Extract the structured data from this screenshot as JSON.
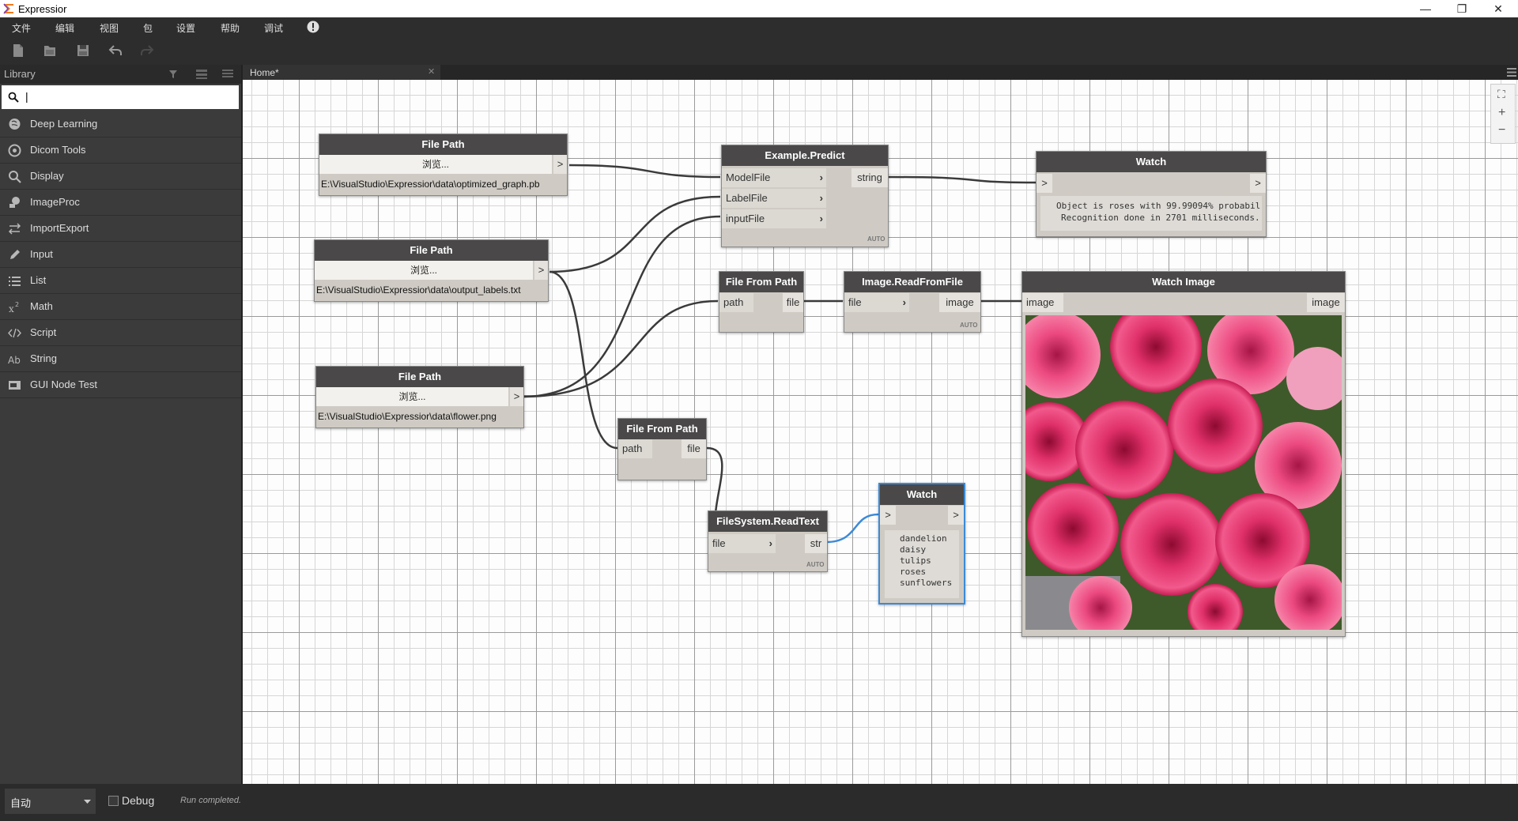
{
  "window": {
    "title": "Expressior",
    "minimize": "—",
    "restore": "❐",
    "close": "✕"
  },
  "menu": {
    "items": [
      "文件",
      "编辑",
      "视图",
      "包",
      "设置",
      "帮助",
      "调试"
    ],
    "info_icon": "info-circle-icon"
  },
  "toolbar": {
    "icons": [
      "new-file-icon",
      "open-file-icon",
      "save-icon",
      "undo-icon",
      "redo-icon"
    ]
  },
  "library": {
    "title": "Library",
    "search_value": "|",
    "items": [
      {
        "label": "Deep Learning",
        "icon": "brain-icon"
      },
      {
        "label": "Dicom Tools",
        "icon": "disc-icon"
      },
      {
        "label": "Display",
        "icon": "magnifier-icon"
      },
      {
        "label": "ImageProc",
        "icon": "image-proc-icon"
      },
      {
        "label": "ImportExport",
        "icon": "swap-arrows-icon"
      },
      {
        "label": "Input",
        "icon": "pencil-icon"
      },
      {
        "label": "List",
        "icon": "list-icon"
      },
      {
        "label": "Math",
        "icon": "x-squared-icon"
      },
      {
        "label": "Script",
        "icon": "code-icon"
      },
      {
        "label": "String",
        "icon": "ab-text-icon"
      },
      {
        "label": "GUI Node Test",
        "icon": "gui-node-icon"
      }
    ]
  },
  "tabs": {
    "home_label": "Home*",
    "close": "✕"
  },
  "nodes": {
    "fp1": {
      "title": "File Path",
      "button": "浏览...",
      "out": ">",
      "path": "E:\\VisualStudio\\Expressior\\data\\optimized_graph.pb"
    },
    "fp2": {
      "title": "File Path",
      "button": "浏览...",
      "out": ">",
      "path": "E:\\VisualStudio\\Expressior\\data\\output_labels.txt"
    },
    "fp3": {
      "title": "File Path",
      "button": "浏览...",
      "out": ">",
      "path": "E:\\VisualStudio\\Expressior\\data\\flower.png"
    },
    "predict": {
      "title": "Example.Predict",
      "inputs": [
        "ModelFile",
        "LabelFile",
        "inputFile"
      ],
      "output": "string",
      "auto": "AUTO"
    },
    "watch1": {
      "title": "Watch",
      "in": ">",
      "out": ">",
      "lines": [
        "Object is roses with 99.99094% probabil",
        "Recognition done in 2701 milliseconds."
      ]
    },
    "ffp1": {
      "title": "File From Path",
      "input": "path",
      "output": "file"
    },
    "readimg": {
      "title": "Image.ReadFromFile",
      "input": "file",
      "output": "image",
      "auto": "AUTO"
    },
    "watchimg": {
      "title": "Watch Image",
      "input": "image",
      "output": "image"
    },
    "ffp2": {
      "title": "File From Path",
      "input": "path",
      "output": "file"
    },
    "readtext": {
      "title": "FileSystem.ReadText",
      "input": "file",
      "output": "str",
      "auto": "AUTO"
    },
    "watch2": {
      "title": "Watch",
      "in": ">",
      "out": ">",
      "lines": [
        "dandelion",
        "daisy",
        "tulips",
        "roses",
        "sunflowers"
      ]
    }
  },
  "status": {
    "run_mode": "自动",
    "debug_label": "Debug",
    "debug_checked": false,
    "message": "Run completed."
  },
  "zoom": {
    "fit": "⛶",
    "in": "+",
    "out": "−"
  },
  "colors": {
    "node_header": "#4a4848",
    "node_body": "#cfcbc4",
    "wire": "#3a3a3a",
    "selected_wire": "#3b8ad9",
    "selected_border": "#3b8ad9"
  }
}
